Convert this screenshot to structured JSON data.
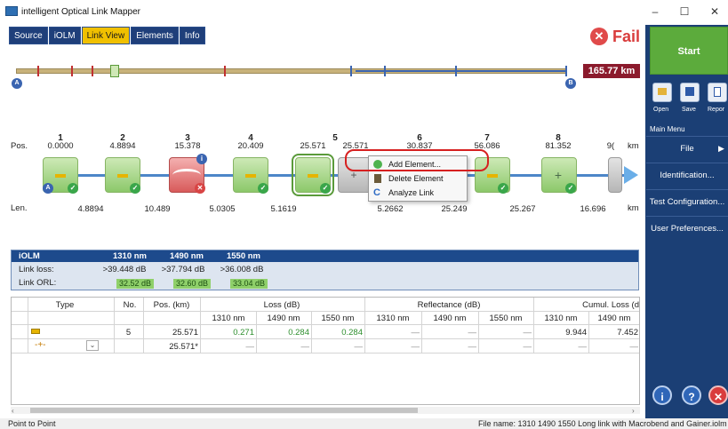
{
  "window": {
    "title": "intelligent Optical Link Mapper",
    "controls": {
      "minimize": "–",
      "maximize": "☐",
      "close": "✕"
    }
  },
  "tabs": [
    {
      "label": "Source",
      "active": false
    },
    {
      "label": "iOLM",
      "active": false
    },
    {
      "label": "Link View",
      "active": true
    },
    {
      "label": "Elements",
      "active": false
    },
    {
      "label": "Info",
      "active": false
    }
  ],
  "status": {
    "icon": "fail-x-icon",
    "label": "Fail",
    "color": "#d93c3c"
  },
  "link_overview": {
    "distance": "165.77 km",
    "start_marker": "A",
    "end_marker": "B"
  },
  "events": {
    "pos_label": "Pos.",
    "len_label": "Len.",
    "unit": "km",
    "items": [
      {
        "number": "1",
        "position": "0.0000",
        "status": "pass",
        "type": "connector-start"
      },
      {
        "number": "2",
        "position": "4.8894",
        "status": "pass",
        "type": "splice"
      },
      {
        "number": "3",
        "position": "15.378",
        "status": "fail",
        "type": "macrobend"
      },
      {
        "number": "4",
        "position": "20.409",
        "status": "pass",
        "type": "splice"
      },
      {
        "number": "5",
        "position": "25.571",
        "status": "pass",
        "type": "splice"
      },
      {
        "number": "",
        "position": "25.571",
        "status": "new",
        "type": "added"
      },
      {
        "number": "6",
        "position": "30.837",
        "status": "pass",
        "type": "splice"
      },
      {
        "number": "7",
        "position": "56.086",
        "status": "pass",
        "type": "splice"
      },
      {
        "number": "8",
        "position": "81.352",
        "status": "pass",
        "type": "gainer"
      },
      {
        "number": "",
        "position": "9(",
        "status": "none",
        "type": "end"
      }
    ],
    "lengths": [
      "4.8894",
      "10.489",
      "5.0305",
      "5.1619",
      "5.2662",
      "25.249",
      "25.267",
      "16.696"
    ]
  },
  "context_menu": {
    "items": [
      {
        "label": "Add Element...",
        "icon": "add-icon"
      },
      {
        "label": "Delete Element",
        "icon": "trash-icon"
      },
      {
        "label": "Analyze Link",
        "icon": "refresh-icon"
      }
    ]
  },
  "summary": {
    "title": "iOLM",
    "wavelengths": [
      "1310 nm",
      "1490 nm",
      "1550 nm"
    ],
    "link_loss_label": "Link loss:",
    "link_loss": [
      ">39.448 dB",
      ">37.794 dB",
      ">36.008 dB"
    ],
    "link_orl_label": "Link ORL:",
    "link_orl": [
      "32.52 dB",
      "32.60 dB",
      "33.04 dB"
    ]
  },
  "table": {
    "headers": {
      "type": "Type",
      "no": "No.",
      "pos": "Pos. (km)",
      "loss": "Loss (dB)",
      "reflectance": "Reflectance (dB)",
      "cumul": "Cumul. Loss (d"
    },
    "wavelengths": [
      "1310 nm",
      "1490 nm",
      "1550 nm"
    ],
    "rows": [
      {
        "type_icon": "splice-icon",
        "no": "5",
        "pos": "25.571",
        "loss": [
          "0.271",
          "0.284",
          "0.284"
        ],
        "reflectance": [
          "—",
          "—",
          "—"
        ],
        "cumul": [
          "9.944",
          "7.452"
        ]
      },
      {
        "type_icon": "unknown-element-icon",
        "no": "",
        "pos": "25.571*",
        "loss": [
          "—",
          "—",
          "—"
        ],
        "reflectance": [
          "—",
          "—",
          "—"
        ],
        "cumul": [
          "—",
          "—"
        ]
      }
    ]
  },
  "sidebar": {
    "start_label": "Start",
    "quick": [
      "Open",
      "Save",
      "Repor"
    ],
    "main_menu_label": "Main Menu",
    "menu": [
      {
        "label": "File",
        "has_arrow": true
      },
      {
        "label": "Identification..."
      },
      {
        "label": "Test Configuration..."
      },
      {
        "label": "User Preferences..."
      }
    ],
    "round_buttons": [
      "i",
      "?",
      "✕"
    ]
  },
  "statusbar": {
    "left": "Point to Point",
    "right": "File name: 1310 1490 1550 Long link with Macrobend and Gainer.iolm"
  }
}
